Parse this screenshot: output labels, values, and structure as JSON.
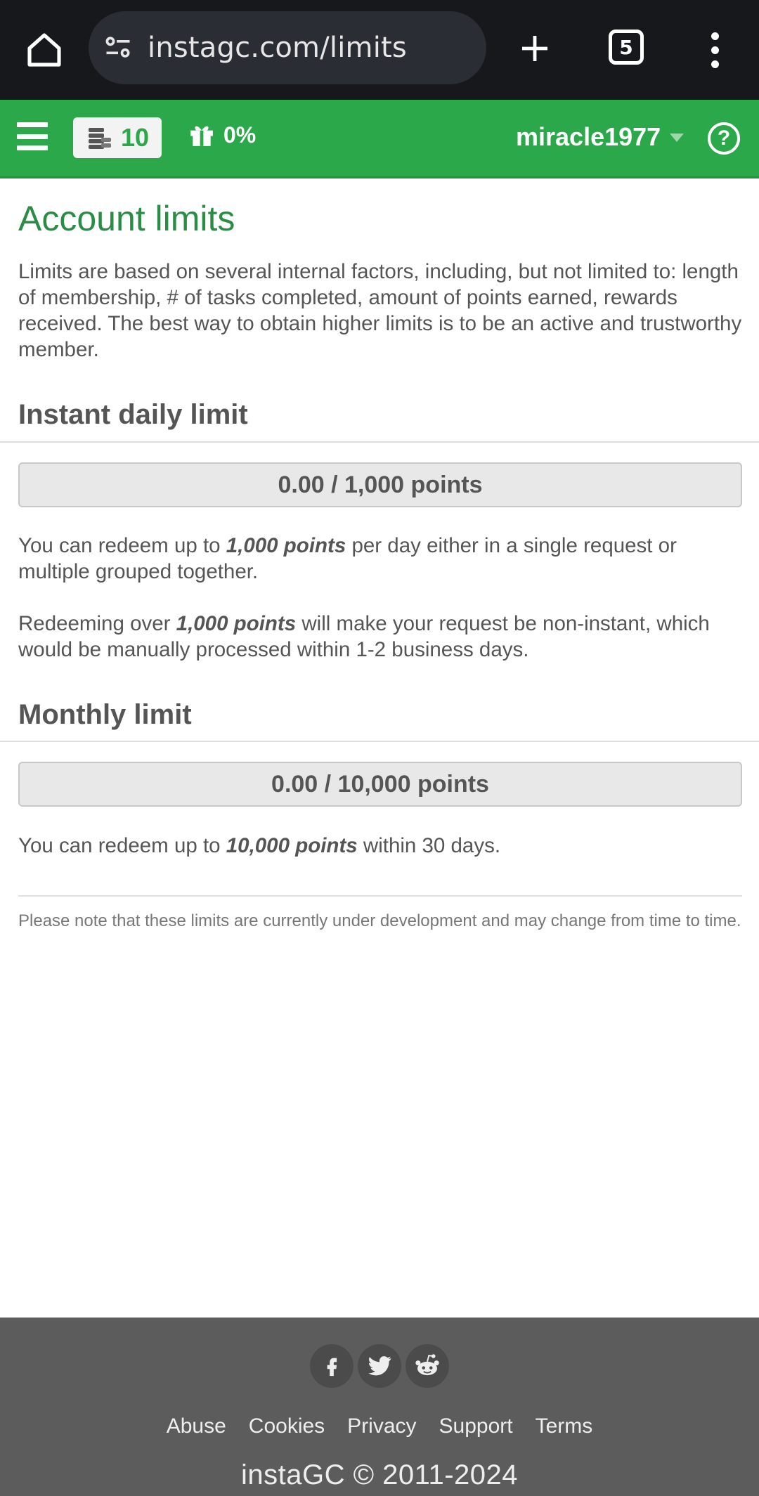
{
  "browser": {
    "url": "instagc.com/limits",
    "tab_count": "5"
  },
  "nav": {
    "points": "10",
    "bonus_percent": "0%",
    "username": "miracle1977",
    "help_label": "?"
  },
  "page": {
    "title": "Account limits",
    "intro": "Limits are based on several internal factors, including, but not limited to: length of membership, # of tasks completed, amount of points earned, rewards received. The best way to obtain higher limits is to be an active and trustworthy member."
  },
  "daily": {
    "heading": "Instant daily limit",
    "used": 0,
    "limit": 1000,
    "bar_text": "0.00 / 1,000 points",
    "p1_before": "You can redeem up to ",
    "p1_bold": "1,000 points",
    "p1_after": " per day either in a single request or multiple grouped together.",
    "p2_before": "Redeeming over ",
    "p2_bold": "1,000 points",
    "p2_after": " will make your request be non-instant, which would be manually processed within 1-2 business days."
  },
  "monthly": {
    "heading": "Monthly limit",
    "used": 0,
    "limit": 10000,
    "bar_text": "0.00 / 10,000 points",
    "p1_before": "You can redeem up to ",
    "p1_bold": "10,000 points",
    "p1_after": " within 30 days."
  },
  "note": "Please note that these limits are currently under development and may change from time to time.",
  "footer": {
    "social": [
      "facebook-icon",
      "twitter-icon",
      "reddit-icon"
    ],
    "links": [
      "Abuse",
      "Cookies",
      "Privacy",
      "Support",
      "Terms"
    ],
    "copyright": "instaGC © 2011-2024"
  },
  "colors": {
    "brand_green": "#2aa84a",
    "title_green": "#2a8c45",
    "footer_bg": "#5c5c5c",
    "browser_bg": "#17181b"
  }
}
